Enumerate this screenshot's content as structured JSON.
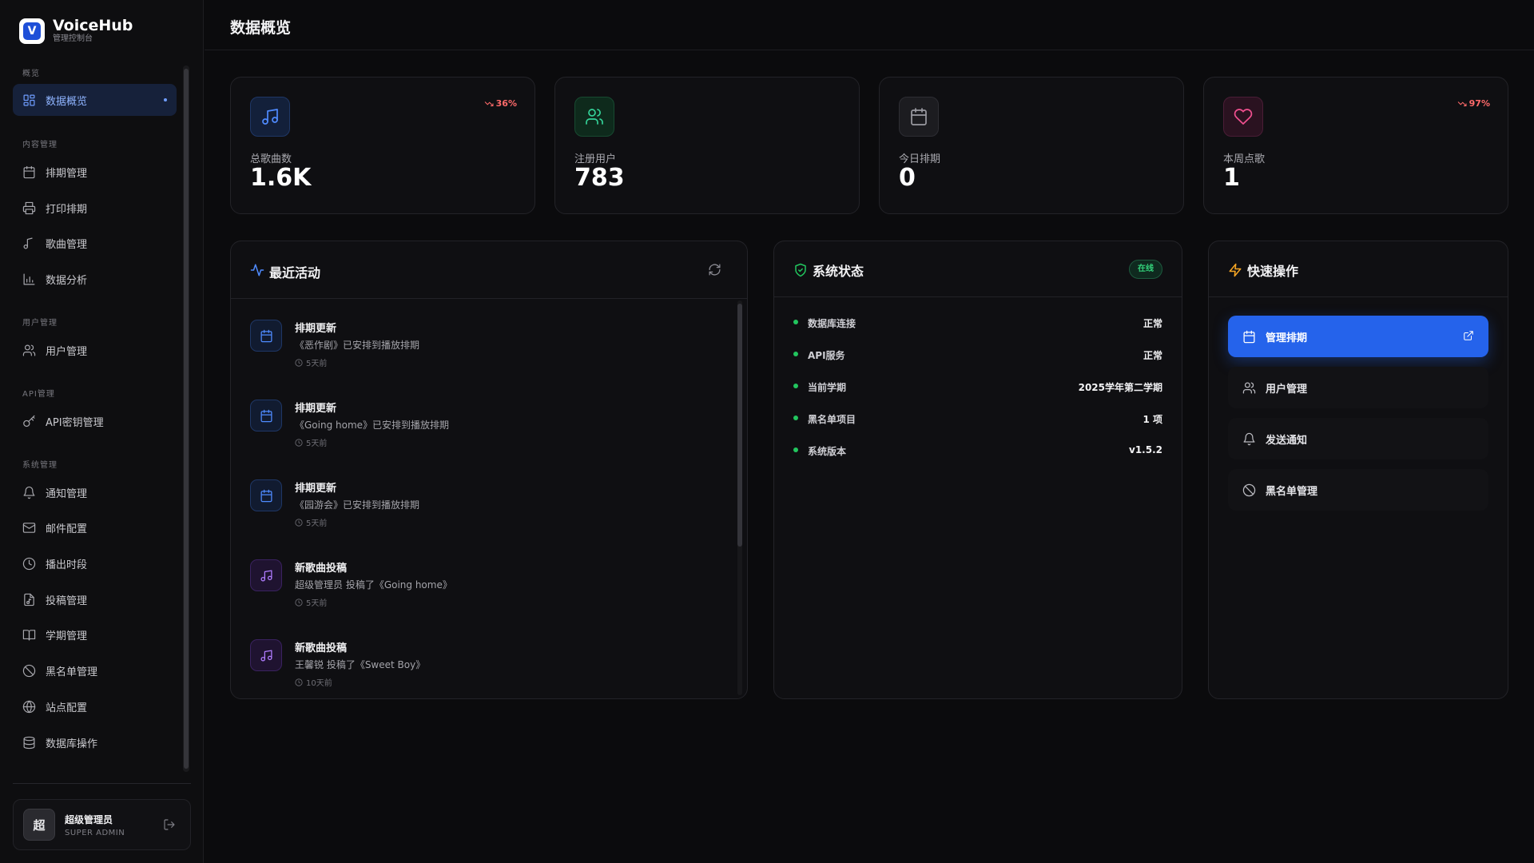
{
  "brand": {
    "name": "VoiceHub",
    "subtitle": "管理控制台",
    "logo_letter": "V"
  },
  "sidebar": {
    "sections": [
      {
        "label": "概览",
        "items": [
          {
            "label": "数据概览",
            "icon": "dashboard-icon",
            "active": true
          }
        ]
      },
      {
        "label": "内容管理",
        "items": [
          {
            "label": "排期管理",
            "icon": "calendar-icon"
          },
          {
            "label": "打印排期",
            "icon": "printer-icon"
          },
          {
            "label": "歌曲管理",
            "icon": "music-icon"
          },
          {
            "label": "数据分析",
            "icon": "chart-icon"
          }
        ]
      },
      {
        "label": "用户管理",
        "items": [
          {
            "label": "用户管理",
            "icon": "users-icon"
          }
        ]
      },
      {
        "label": "API管理",
        "items": [
          {
            "label": "API密钥管理",
            "icon": "key-icon"
          }
        ]
      },
      {
        "label": "系统管理",
        "items": [
          {
            "label": "通知管理",
            "icon": "bell-icon"
          },
          {
            "label": "邮件配置",
            "icon": "mail-icon"
          },
          {
            "label": "播出时段",
            "icon": "clock-icon"
          },
          {
            "label": "投稿管理",
            "icon": "file-music-icon"
          },
          {
            "label": "学期管理",
            "icon": "book-icon"
          },
          {
            "label": "黑名单管理",
            "icon": "ban-icon"
          },
          {
            "label": "站点配置",
            "icon": "globe-icon"
          },
          {
            "label": "数据库操作",
            "icon": "database-icon"
          }
        ]
      }
    ],
    "user": {
      "avatar": "超",
      "name": "超级管理员",
      "role": "SUPER ADMIN"
    }
  },
  "header": {
    "title": "数据概览"
  },
  "stats": [
    {
      "label": "总歌曲数",
      "value": "1.6K",
      "icon": "music-icon",
      "trend": "36%",
      "color": "#3b82f6"
    },
    {
      "label": "注册用户",
      "value": "783",
      "icon": "users-icon",
      "trend": "",
      "color": "#22c55e"
    },
    {
      "label": "今日排期",
      "value": "0",
      "icon": "calendar-icon",
      "trend": "",
      "color": "#8a8a92"
    },
    {
      "label": "本周点歌",
      "value": "1",
      "icon": "heart-icon",
      "trend": "97%",
      "color": "#ec4899"
    }
  ],
  "activity": {
    "title": "最近活动",
    "items": [
      {
        "type": "schedule",
        "title": "排期更新",
        "desc": "《恶作剧》已安排到播放排期",
        "time": "5天前"
      },
      {
        "type": "schedule",
        "title": "排期更新",
        "desc": "《Going home》已安排到播放排期",
        "time": "5天前"
      },
      {
        "type": "schedule",
        "title": "排期更新",
        "desc": "《园游会》已安排到播放排期",
        "time": "5天前"
      },
      {
        "type": "song",
        "title": "新歌曲投稿",
        "desc": "超级管理员 投稿了《Going home》",
        "time": "5天前"
      },
      {
        "type": "song",
        "title": "新歌曲投稿",
        "desc": "王馨锐 投稿了《Sweet Boy》",
        "time": "10天前"
      }
    ]
  },
  "system": {
    "title": "系统状态",
    "badge": "在线",
    "rows": [
      {
        "key": "数据库连接",
        "value": "正常"
      },
      {
        "key": "API服务",
        "value": "正常"
      },
      {
        "key": "当前学期",
        "value": "2025学年第二学期"
      },
      {
        "key": "黑名单项目",
        "value": "1 项"
      },
      {
        "key": "系统版本",
        "value": "v1.5.2"
      }
    ]
  },
  "quick": {
    "title": "快速操作",
    "items": [
      {
        "label": "管理排期",
        "icon": "calendar-icon",
        "primary": true
      },
      {
        "label": "用户管理",
        "icon": "users-icon"
      },
      {
        "label": "发送通知",
        "icon": "bell-icon"
      },
      {
        "label": "黑名单管理",
        "icon": "ban-icon"
      }
    ]
  }
}
